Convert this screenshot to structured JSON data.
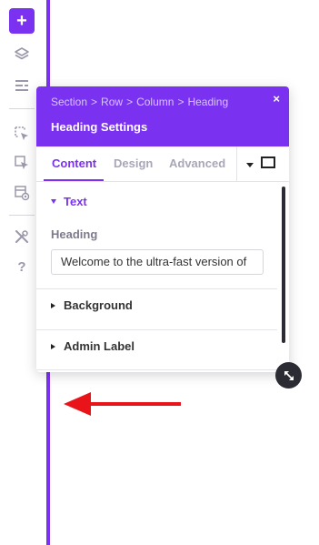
{
  "toolbar": {
    "add_label": "+",
    "help_label": "?",
    "icons": [
      "plus-icon",
      "layers-icon",
      "list-icon",
      "cursor-select-icon",
      "cursor-select-alt-icon",
      "preview-icon",
      "tools-icon",
      "help-icon"
    ]
  },
  "modal": {
    "breadcrumb": [
      "Section",
      "Row",
      "Column",
      "Heading"
    ],
    "breadcrumb_sep": ">",
    "title": "Heading Settings",
    "close_label": "×",
    "tabs": [
      "Content",
      "Design",
      "Advanced"
    ],
    "active_tab": "Content",
    "sections": {
      "text": {
        "label": "Text",
        "field_label": "Heading",
        "field_value": "Welcome to the ultra-fast version of"
      },
      "background": {
        "label": "Background"
      },
      "admin_label": {
        "label": "Admin Label"
      }
    }
  },
  "colors": {
    "accent": "#7b32f0",
    "header_bg": "#7b32f0",
    "arrow": "#e8141a",
    "dark_button": "#2b2b34"
  }
}
